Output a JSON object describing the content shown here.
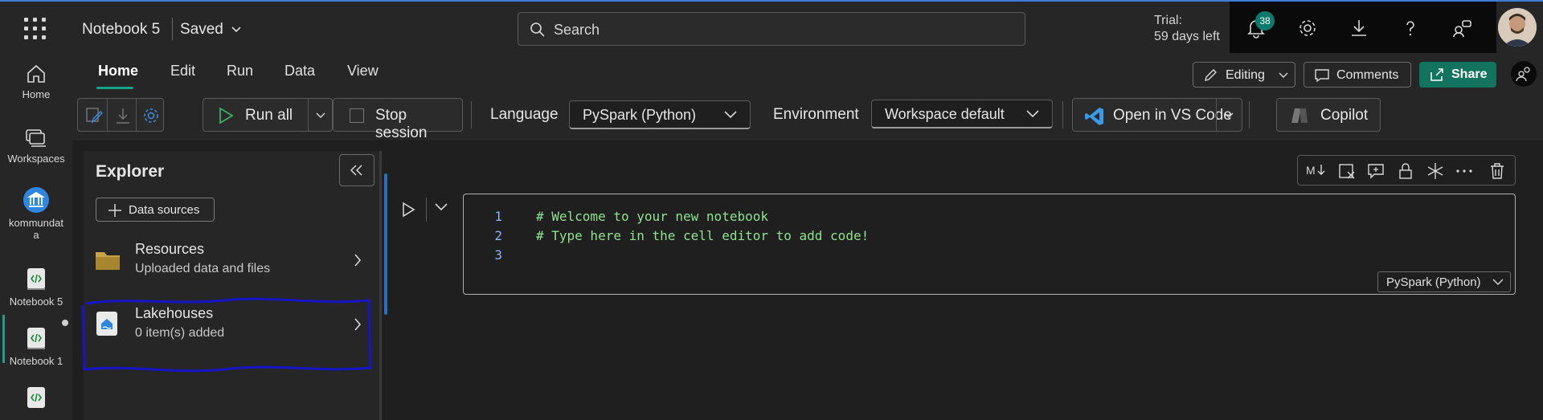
{
  "app": {
    "notebook_title": "Notebook 5",
    "save_status": "Saved",
    "search_placeholder": "Search",
    "trial_line1": "Trial:",
    "trial_line2": "59 days left",
    "notifications_count": "38"
  },
  "rail": [
    {
      "label": "Home",
      "icon": "home-icon"
    },
    {
      "label": "Workspaces",
      "icon": "workspaces-icon"
    },
    {
      "label_line1": "kommundat",
      "label_line2": "a",
      "icon": "workspace-kommundata-icon"
    },
    {
      "label": "Notebook 5",
      "icon": "notebook-icon"
    },
    {
      "label": "Notebook 1",
      "icon": "notebook-icon"
    },
    {
      "label": "",
      "icon": "notebook-icon"
    }
  ],
  "tabs": [
    "Home",
    "Edit",
    "Run",
    "Data",
    "View"
  ],
  "actions": {
    "editing": "Editing",
    "comments": "Comments",
    "share": "Share"
  },
  "toolbar": {
    "run_all": "Run all",
    "stop_session": "Stop session",
    "language_label": "Language",
    "language_value": "PySpark (Python)",
    "environment_label": "Environment",
    "environment_value": "Workspace default",
    "open_vscode": "Open in VS Code",
    "copilot": "Copilot"
  },
  "explorer": {
    "title": "Explorer",
    "data_sources": "Data sources",
    "items": [
      {
        "title": "Resources",
        "subtitle": "Uploaded data and files",
        "icon": "folder-icon"
      },
      {
        "title": "Lakehouses",
        "subtitle": "0 item(s) added",
        "icon": "lakehouse-icon"
      }
    ]
  },
  "cell": {
    "lines": [
      {
        "num": "1",
        "code": "# Welcome to your new notebook"
      },
      {
        "num": "2",
        "code": "# Type here in the cell editor to add code!"
      },
      {
        "num": "3",
        "code": ""
      }
    ],
    "language": "PySpark (Python)"
  },
  "colors": {
    "accent": "#17a08a",
    "share_bg": "#12745f",
    "highlight_stroke": "#1616c8",
    "code_comment": "#8fe28f"
  }
}
